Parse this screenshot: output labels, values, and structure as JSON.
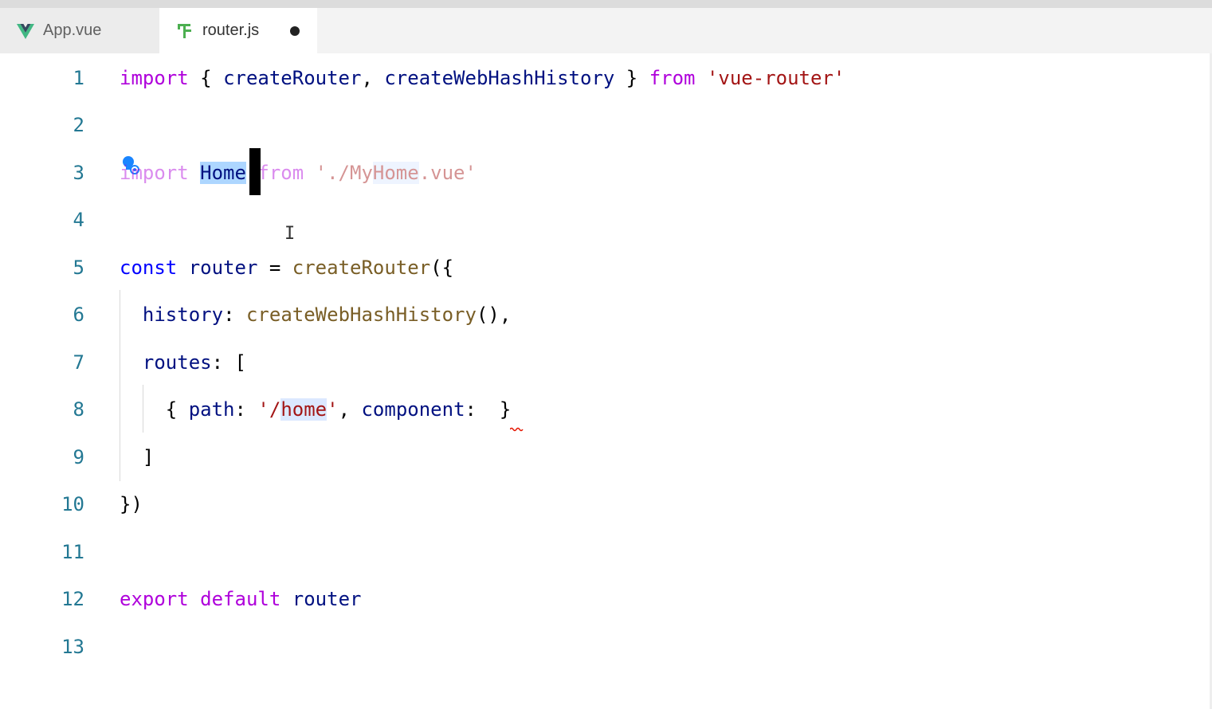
{
  "tabs": [
    {
      "label": "App.vue",
      "icon": "vue-logo-icon",
      "active": false
    },
    {
      "label": "router.js",
      "icon": "router-file-icon",
      "active": true,
      "modified": true
    }
  ],
  "colors": {
    "keyword": "#af00db",
    "variable": "#001080",
    "string": "#a31515",
    "function": "#795e26",
    "line_number": "#237893",
    "selection": "#add6ff"
  },
  "editor": {
    "line_numbers": [
      "1",
      "2",
      "3",
      "4",
      "5",
      "6",
      "7",
      "8",
      "9",
      "10",
      "11",
      "12",
      "13"
    ],
    "lines": {
      "l1": {
        "t1": "import",
        "t2": " { ",
        "t3": "createRouter",
        "t4": ", ",
        "t5": "createWebHashHistory",
        "t6": " } ",
        "t7": "from",
        "t8": " ",
        "t9": "'vue-router'"
      },
      "l3": {
        "t1": "import",
        "t2": " ",
        "t3": "Home",
        "t4": " ",
        "t5": "from",
        "t6": " ",
        "t7": "'./My",
        "t8": "Home",
        "t9": ".vue'"
      },
      "l5": {
        "t1": "const",
        "t2": " ",
        "t3": "router",
        "t4": " = ",
        "t5": "createRouter",
        "t6": "({"
      },
      "l6": {
        "t1": "  ",
        "t2": "history",
        "t3": ": ",
        "t4": "createWebHashHistory",
        "t5": "(),"
      },
      "l7": {
        "t1": "  ",
        "t2": "routes",
        "t3": ": ["
      },
      "l8": {
        "t1": "    { ",
        "t2": "path",
        "t3": ": ",
        "t4": "'/",
        "t5": "home",
        "t6": "'",
        "t7": ", ",
        "t8": "component",
        "t9": ":  }"
      },
      "l9": {
        "t1": "  ]"
      },
      "l10": {
        "t1": "})"
      },
      "l12": {
        "t1": "export",
        "t2": " ",
        "t3": "default",
        "t4": " ",
        "t5": "router"
      }
    },
    "ibeam_glyph": "I"
  }
}
